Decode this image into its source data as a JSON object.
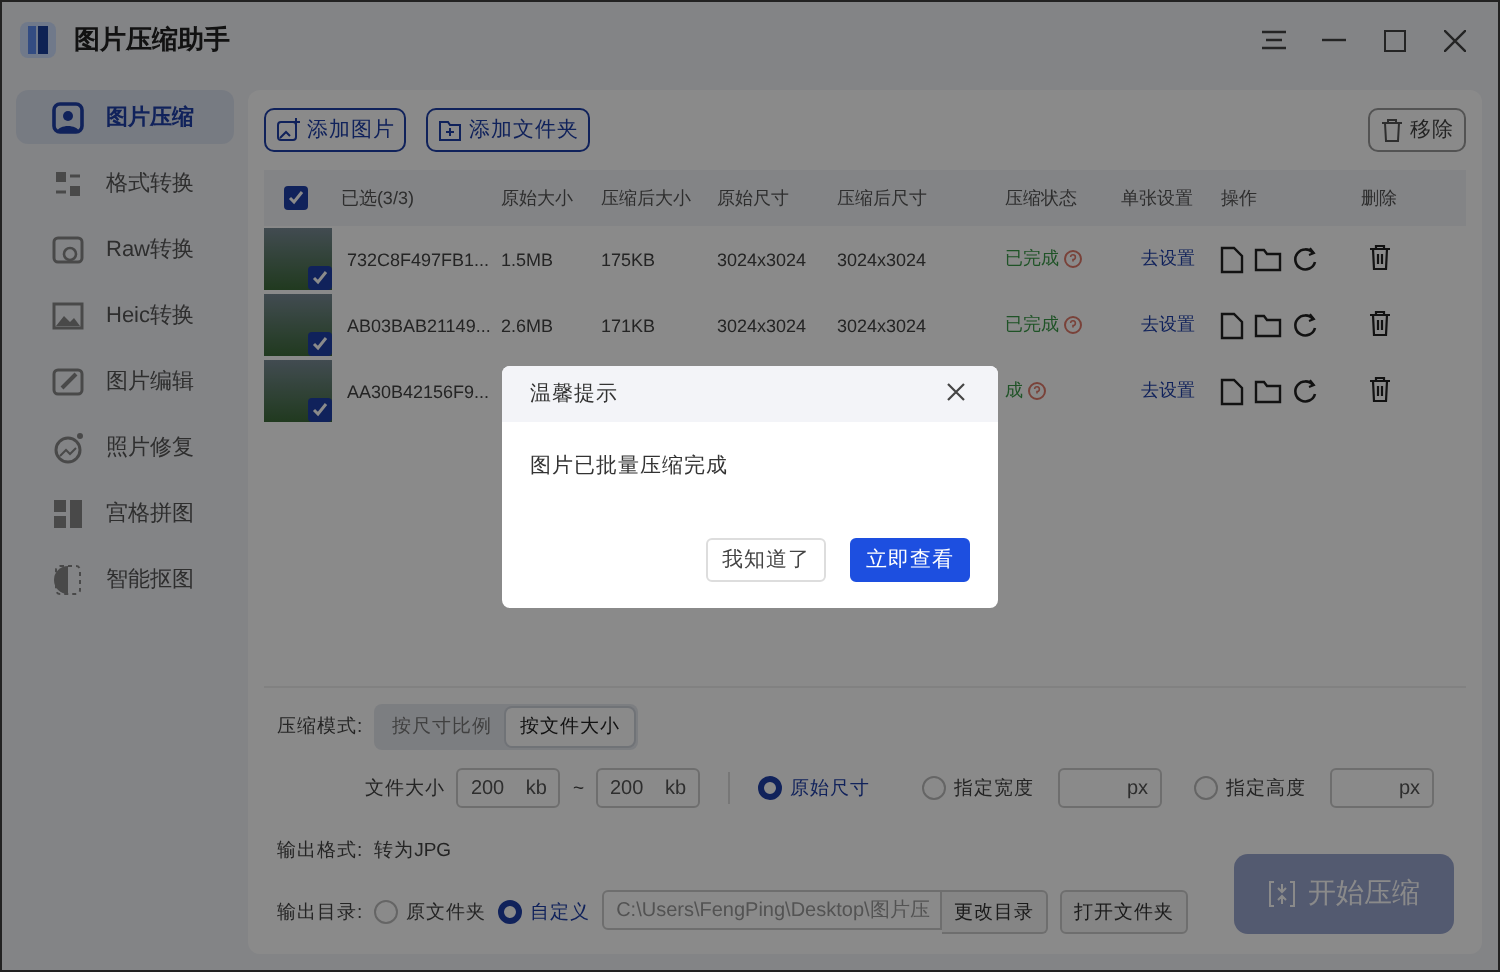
{
  "window": {
    "title": "图片压缩助手"
  },
  "sidebar": {
    "items": [
      {
        "label": "图片压缩",
        "selected": true
      },
      {
        "label": "格式转换",
        "selected": false
      },
      {
        "label": "Raw转换",
        "selected": false
      },
      {
        "label": "Heic转换",
        "selected": false
      },
      {
        "label": "图片编辑",
        "selected": false
      },
      {
        "label": "照片修复",
        "selected": false
      },
      {
        "label": "宫格拼图",
        "selected": false
      },
      {
        "label": "智能抠图",
        "selected": false
      }
    ]
  },
  "toolbar": {
    "add_image": "添加图片",
    "add_folder": "添加文件夹",
    "remove": "移除"
  },
  "table": {
    "all_checked": true,
    "columns": [
      "已选(3/3)",
      "原始大小",
      "压缩后大小",
      "原始尺寸",
      "压缩后尺寸",
      "压缩状态",
      "单张设置",
      "操作",
      "删除"
    ],
    "rows": [
      {
        "checked": true,
        "name": "732C8F497FB1...",
        "original_size": "1.5MB",
        "compressed_size": "175KB",
        "original_dims": "3024x3024",
        "compressed_dims": "3024x3024",
        "status": "已完成",
        "setting": "去设置"
      },
      {
        "checked": true,
        "name": "AB03BAB21149...",
        "original_size": "2.6MB",
        "compressed_size": "171KB",
        "original_dims": "3024x3024",
        "compressed_dims": "3024x3024",
        "status": "已完成",
        "setting": "去设置"
      },
      {
        "checked": true,
        "name": "AA30B42156F9...",
        "status": "成",
        "setting": "去设置"
      }
    ]
  },
  "settings": {
    "mode_label": "压缩模式:",
    "modes": [
      {
        "label": "按尺寸比例",
        "selected": false
      },
      {
        "label": "按文件大小",
        "selected": true
      }
    ],
    "file_size_label": "文件大小",
    "min_size": "200",
    "min_unit": "kb",
    "max_size": "200",
    "max_unit": "kb",
    "range_sep": "~",
    "dimension_options": [
      {
        "label": "原始尺寸",
        "selected": true,
        "kind": "plain"
      },
      {
        "label": "指定宽度",
        "selected": false,
        "kind": "field",
        "unit": "px"
      },
      {
        "label": "指定高度",
        "selected": false,
        "kind": "field",
        "unit": "px"
      }
    ],
    "format_label": "输出格式:",
    "format_value": "转为JPG",
    "output_label": "输出目录:",
    "output_options": [
      {
        "label": "原文件夹",
        "selected": false
      },
      {
        "label": "自定义",
        "selected": true
      }
    ],
    "output_path": "C:\\Users\\FengPing\\Desktop\\图片压",
    "change_dir": "更改目录",
    "open_folder": "打开文件夹",
    "start": {
      "label": "开始压缩",
      "disabled": true
    }
  },
  "dialog": {
    "title": "温馨提示",
    "message": "图片已批量压缩完成",
    "buttons": [
      {
        "label": "我知道了",
        "kind": "secondary"
      },
      {
        "label": "立即查看",
        "kind": "primary"
      }
    ]
  }
}
